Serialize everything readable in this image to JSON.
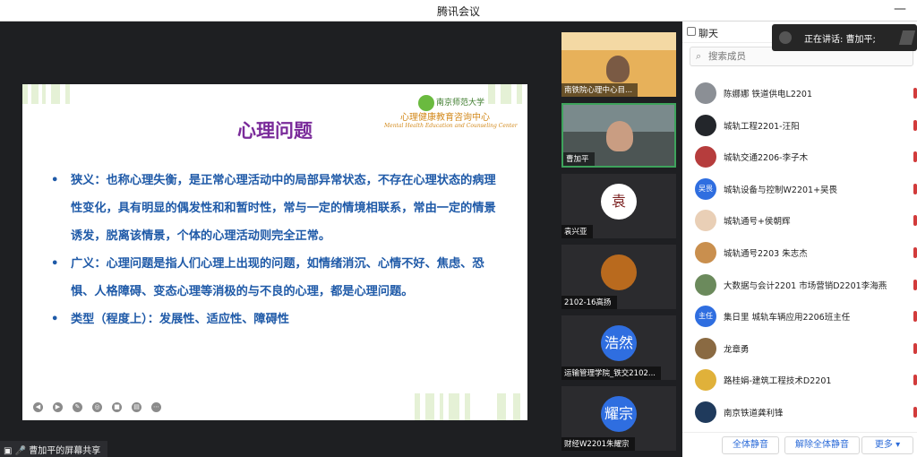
{
  "app": {
    "title": "腾讯会议",
    "minimize_glyph": "—"
  },
  "slide": {
    "logo_top": "南京师范大学",
    "logo_mid": "心理健康教育咨询中心",
    "logo_en": "Mental Health Education and Counseling Center",
    "title": "心理问题",
    "bullet_glyph": "•",
    "bullets": [
      "狭义：也称心理失衡，是正常心理活动中的局部异常状态，不存在心理状态的病理性变化，具有明显的偶发性和和暂时性，常与一定的情境相联系，常由一定的情景诱发，脱离该情景，个体的心理活动则完全正常。",
      "广义：心理问题是指人们心理上出现的问题，如情绪消沉、心情不好、焦虑、恐惧、人格障碍、变态心理等消极的与不良的心理，都是心理问题。",
      "类型（程度上）：发展性、适应性、障碍性"
    ],
    "controls": [
      "prev-icon",
      "next-icon",
      "pen-icon",
      "screenshot-icon",
      "video-icon",
      "subtitle-icon",
      "more-icon"
    ]
  },
  "presenter": {
    "label": "曹加平的屏幕共享",
    "icons": [
      "screen-icon",
      "mic-icon"
    ]
  },
  "videos": [
    {
      "name": "南铁院心理中心目...",
      "avatar_text": ""
    },
    {
      "name": "曹加平",
      "avatar_text": ""
    },
    {
      "name": "袁兴亚",
      "avatar_text": "袁"
    },
    {
      "name": "2102-16高扬",
      "avatar_text": ""
    },
    {
      "name": "运输管理学院_铁交2102...",
      "avatar_text": "浩然"
    },
    {
      "name": "财经W2201朱耀宗",
      "avatar_text": "耀宗"
    }
  ],
  "chat": {
    "title": "聊天",
    "search_placeholder": "搜索成员",
    "members": [
      {
        "name": "陈娜娜 铁道供电L2201",
        "avatar_text": "",
        "avatar_color": "#8b8f95"
      },
      {
        "name": "城轨工程2201-汪阳",
        "avatar_text": "",
        "avatar_color": "#23262b"
      },
      {
        "name": "城轨交通2206-李子木",
        "avatar_text": "",
        "avatar_color": "#b63d3d"
      },
      {
        "name": "城轨设备与控制W2201+吴畏",
        "avatar_text": "吴畏",
        "avatar_color": "#2f6ee0"
      },
      {
        "name": "城轨通号+侯朝辉",
        "avatar_text": "",
        "avatar_color": "#e9cfb6"
      },
      {
        "name": "城轨通号2203 朱志杰",
        "avatar_text": "",
        "avatar_color": "#c98f4e"
      },
      {
        "name": "大数据与会计2201 市场营销D2201李海燕",
        "avatar_text": "",
        "avatar_color": "#6b8a5c"
      },
      {
        "name": "集日里 城轨车辆应用2206班主任",
        "avatar_text": "主任",
        "avatar_color": "#2f6ee0"
      },
      {
        "name": "龙章勇",
        "avatar_text": "",
        "avatar_color": "#8a6a42"
      },
      {
        "name": "路桂娟-建筑工程技术D2201",
        "avatar_text": "",
        "avatar_color": "#e0b13a"
      },
      {
        "name": "南京铁道龚利锋",
        "avatar_text": "",
        "avatar_color": "#1f3a5c"
      }
    ],
    "mute_all": "全体静音",
    "unmute_all": "解除全体静音",
    "more": "更多"
  },
  "speaking": {
    "label": "正在讲话: 曹加平;"
  }
}
